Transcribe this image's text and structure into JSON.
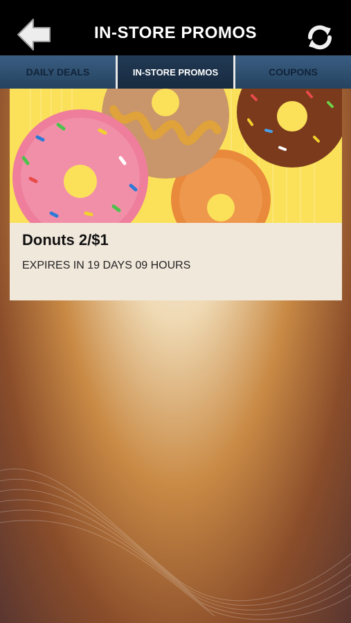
{
  "header": {
    "title": "IN-STORE PROMOS"
  },
  "tabs": [
    {
      "label": "DAILY DEALS"
    },
    {
      "label": "IN-STORE PROMOS"
    },
    {
      "label": "COUPONS"
    }
  ],
  "active_tab": "IN-STORE PROMOS",
  "promos": [
    {
      "title": "Donuts 2/$1",
      "expiry": "EXPIRES IN 19 DAYS 09 HOURS"
    }
  ],
  "colors": {
    "header_bg": "#000000",
    "tab_bg": "#2f4e6e",
    "tab_active_bg": "#1b2f46"
  },
  "icons": {
    "back": "arrow-left-icon",
    "refresh": "refresh-icon"
  }
}
